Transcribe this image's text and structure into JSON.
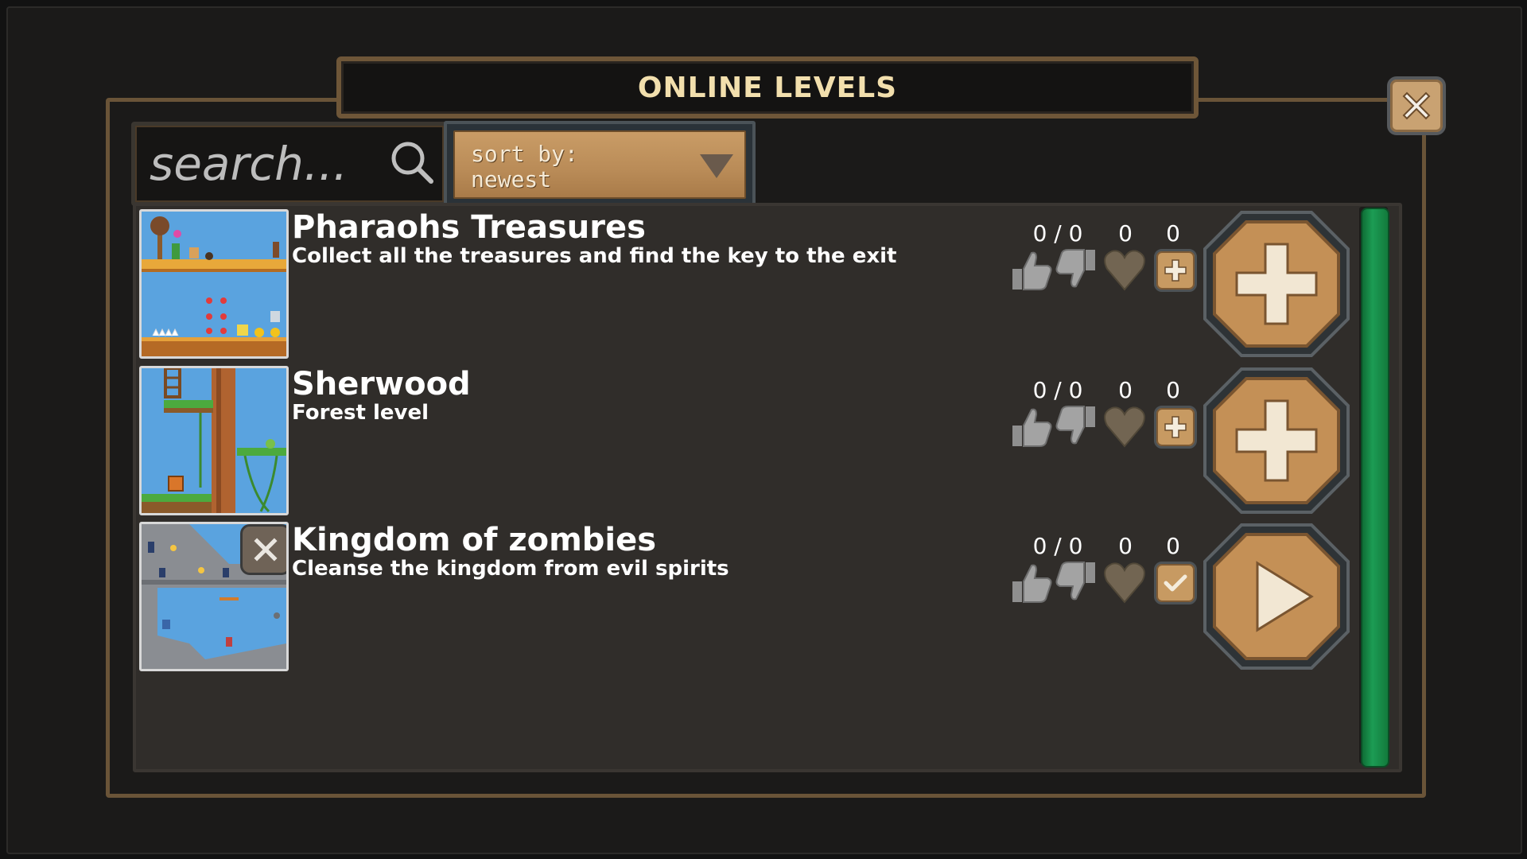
{
  "window": {
    "title": "ONLINE LEVELS"
  },
  "search": {
    "placeholder": "search..."
  },
  "sort": {
    "label": "sort by:",
    "value": "newest"
  },
  "levels": [
    {
      "name": "Pharaohs Treasures",
      "description": "Collect all the treasures and find the key to the exit",
      "rating": "0 / 0",
      "favorites": "0",
      "plays": "0",
      "status": "not-downloaded",
      "small_icon": "plus-icon",
      "big_icon": "plus-icon",
      "thumbnail": "desert-level-thumbnail"
    },
    {
      "name": "Sherwood",
      "description": "Forest level",
      "rating": "0 / 0",
      "favorites": "0",
      "plays": "0",
      "status": "not-downloaded",
      "small_icon": "plus-icon",
      "big_icon": "plus-icon",
      "thumbnail": "forest-level-thumbnail"
    },
    {
      "name": "Kingdom of zombies",
      "description": "Cleanse the kingdom from evil spirits",
      "rating": "0 / 0",
      "favorites": "0",
      "plays": "0",
      "status": "downloaded",
      "small_icon": "check-icon",
      "big_icon": "play-icon",
      "thumbnail": "castle-level-thumbnail"
    }
  ],
  "colors": {
    "panel_border": "#6a5438",
    "title_text": "#f2dfad",
    "wood_button": "#c49056",
    "scrollbar": "#1c9c54",
    "list_background": "#302d2a"
  }
}
